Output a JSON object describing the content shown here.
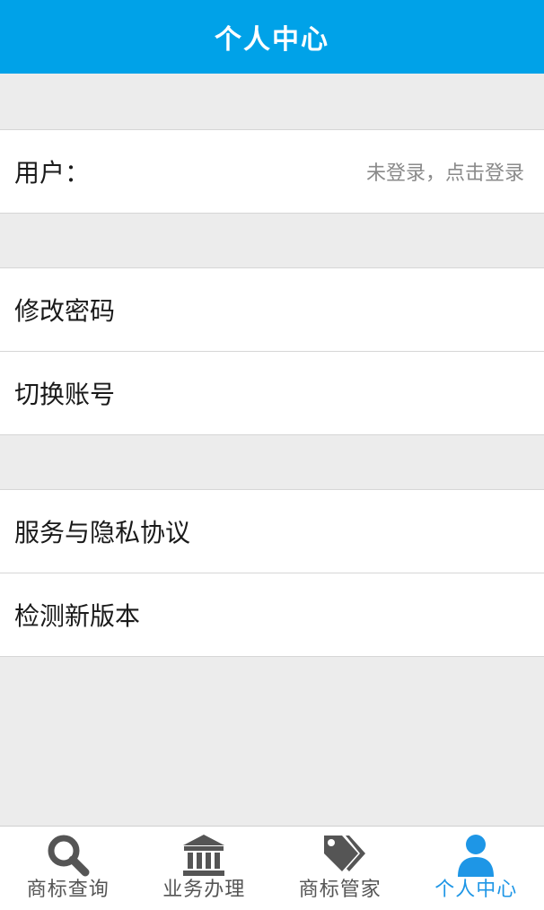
{
  "header": {
    "title": "个人中心"
  },
  "user_row": {
    "label": "用户：",
    "status": "未登录，点击登录"
  },
  "menu_group_1": [
    {
      "label": "修改密码"
    },
    {
      "label": "切换账号"
    }
  ],
  "menu_group_2": [
    {
      "label": "服务与隐私协议"
    },
    {
      "label": "检测新版本"
    }
  ],
  "tabbar": {
    "active_color": "#1e96e6",
    "items": [
      {
        "label": "商标查询",
        "icon": "search-icon",
        "active": false
      },
      {
        "label": "业务办理",
        "icon": "bank-icon",
        "active": false
      },
      {
        "label": "商标管家",
        "icon": "tag-icon",
        "active": false
      },
      {
        "label": "个人中心",
        "icon": "user-icon",
        "active": true
      }
    ]
  },
  "colors": {
    "header_bg": "#00a2e8",
    "page_bg": "#ececec",
    "row_bg": "#ffffff"
  }
}
